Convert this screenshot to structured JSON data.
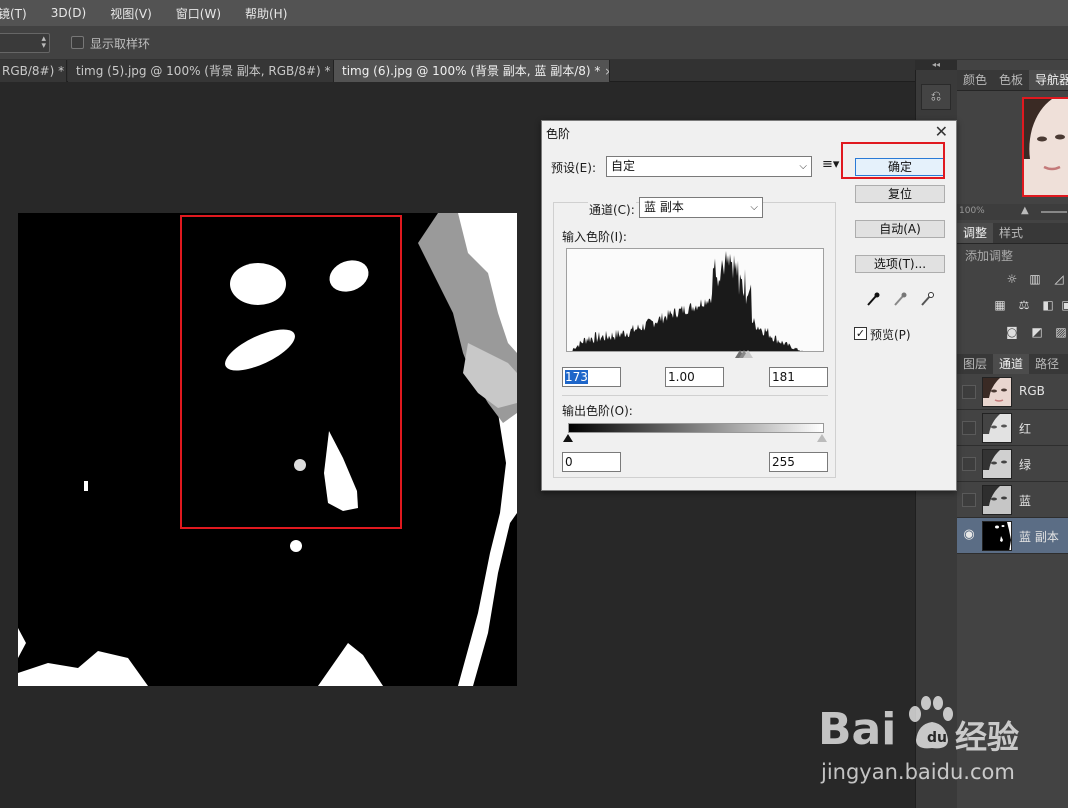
{
  "menu": {
    "items": [
      "镜(T)",
      "3D(D)",
      "视图(V)",
      "窗口(W)",
      "帮助(H)"
    ]
  },
  "options_bar": {
    "show_sampling_ring_label": "显示取样环",
    "show_sampling_ring_checked": false
  },
  "tabs": [
    {
      "label": "RGB/8#) *",
      "active": false
    },
    {
      "label": "timg (5).jpg @ 100% (背景 副本, RGB/8#) *",
      "active": false
    },
    {
      "label": "timg (6).jpg @ 100% (背景 副本, 蓝 副本/8) *",
      "active": true
    }
  ],
  "tab_close_glyph": "×",
  "right_panel": {
    "top_tabs": [
      "颜色",
      "色板",
      "导航器"
    ],
    "zoom_text": "100%",
    "adjust_tabs": [
      "调整",
      "样式"
    ],
    "add_adjustment_label": "添加调整",
    "layer_tabs": [
      "图层",
      "通道",
      "路径"
    ],
    "channels": [
      {
        "name": "RGB",
        "visible": false,
        "selected": false
      },
      {
        "name": "红",
        "visible": false,
        "selected": false
      },
      {
        "name": "绿",
        "visible": false,
        "selected": false
      },
      {
        "name": "蓝",
        "visible": false,
        "selected": false
      },
      {
        "name": "蓝 副本",
        "visible": true,
        "selected": true
      }
    ]
  },
  "levels_dialog": {
    "title": "色阶",
    "preset_label": "预设(E):",
    "preset_value": "自定",
    "channel_label": "通道(C):",
    "channel_value": "蓝 副本",
    "input_levels_label": "输入色阶(I):",
    "input_black": "173",
    "input_gamma": "1.00",
    "input_white": "181",
    "output_levels_label": "输出色阶(O):",
    "output_black": "0",
    "output_white": "255",
    "buttons": {
      "ok": "确定",
      "reset": "复位",
      "auto": "自动(A)",
      "options": "选项(T)..."
    },
    "preview_label": "预览(P)",
    "preview_checked": true
  },
  "watermark": {
    "brand": "Bai",
    "brand_suffix": "经验",
    "url": "jingyan.baidu.com"
  },
  "colors": {
    "highlight_red": "#e0191f",
    "selected_layer": "#5b6d85",
    "default_button_border": "#2a7ad6"
  }
}
